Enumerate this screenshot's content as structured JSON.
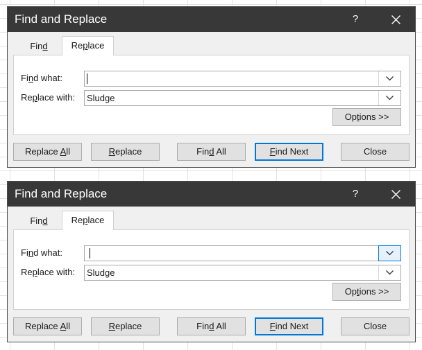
{
  "dialogs": [
    {
      "title": "Find and Replace",
      "help_label": "?",
      "tabs": [
        {
          "pre": "Fin",
          "key": "d",
          "post": ""
        },
        {
          "pre": "Re",
          "key": "p",
          "post": "lace"
        }
      ],
      "find_what": {
        "label_pre": "Fi",
        "label_key": "n",
        "label_post": "d what:",
        "value": ""
      },
      "replace_with": {
        "label_pre": "Re",
        "label_key": "p",
        "label_post": "lace with:",
        "value": "Sludge"
      },
      "options": {
        "pre": "Op",
        "key": "t",
        "post": "ions >>"
      },
      "buttons": {
        "replace_all": {
          "pre": "Replace ",
          "key": "A",
          "post": "ll"
        },
        "replace": {
          "pre": "",
          "key": "R",
          "post": "eplace"
        },
        "find_all": {
          "pre": "Fin",
          "key": "d",
          "post": " All"
        },
        "find_next": {
          "pre": "",
          "key": "F",
          "post": "ind Next"
        },
        "close": {
          "pre": "Close",
          "key": "",
          "post": ""
        }
      },
      "find_arrow_focused": false
    },
    {
      "title": "Find and Replace",
      "help_label": "?",
      "tabs": [
        {
          "pre": "Fin",
          "key": "d",
          "post": ""
        },
        {
          "pre": "Re",
          "key": "p",
          "post": "lace"
        }
      ],
      "find_what": {
        "label_pre": "Fi",
        "label_key": "n",
        "label_post": "d what:",
        "value": ""
      },
      "replace_with": {
        "label_pre": "Re",
        "label_key": "p",
        "label_post": "lace with:",
        "value": "Sludge"
      },
      "options": {
        "pre": "Op",
        "key": "t",
        "post": "ions >>"
      },
      "buttons": {
        "replace_all": {
          "pre": "Replace ",
          "key": "A",
          "post": "ll"
        },
        "replace": {
          "pre": "",
          "key": "R",
          "post": "eplace"
        },
        "find_all": {
          "pre": "Fin",
          "key": "d",
          "post": " All"
        },
        "find_next": {
          "pre": "",
          "key": "F",
          "post": "ind Next"
        },
        "close": {
          "pre": "Close",
          "key": "",
          "post": ""
        }
      },
      "find_arrow_focused": true
    }
  ]
}
